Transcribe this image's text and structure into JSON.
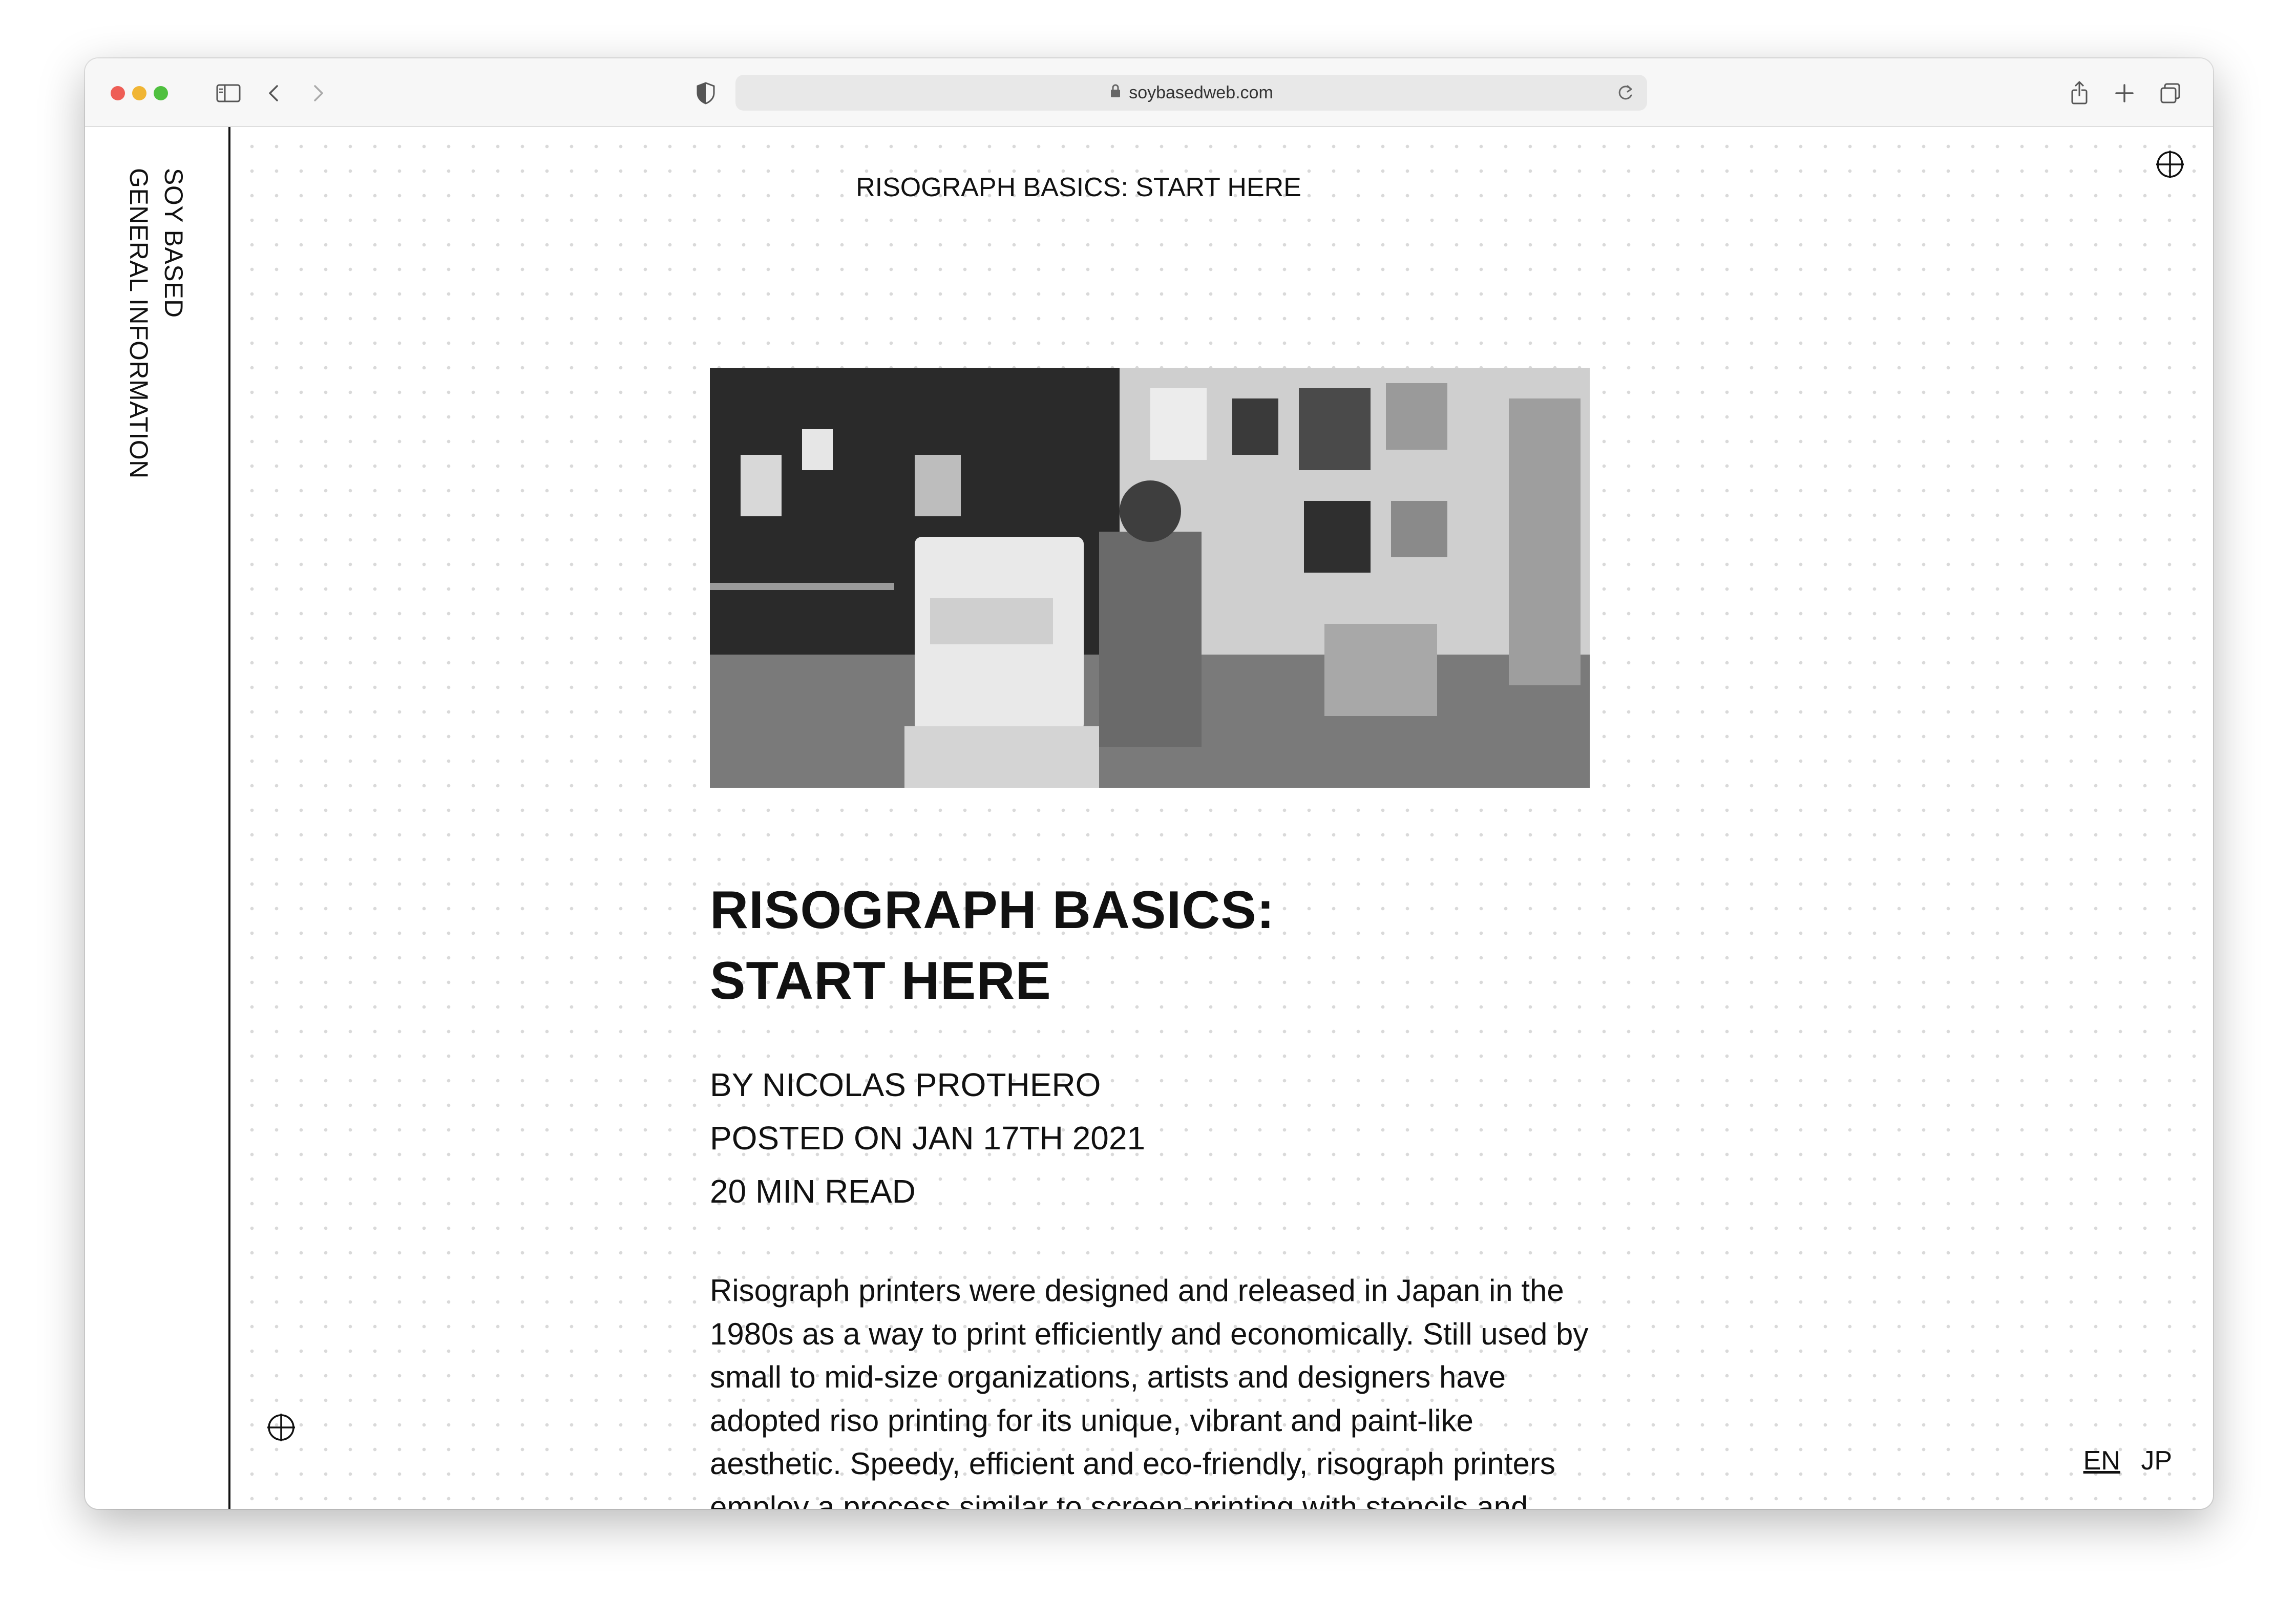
{
  "browser": {
    "url": "soybasedweb.com"
  },
  "sidebar": {
    "brand": "SOY BASED",
    "info": "GENERAL INFORMATION"
  },
  "page": {
    "header_title": "RISOGRAPH BASICS: START HERE"
  },
  "article": {
    "title_line1": "RISOGRAPH BASICS:",
    "title_line2": "START HERE",
    "author": "BY NICOLAS PROTHERO",
    "posted": "POSTED ON JAN 17TH 2021",
    "read_time": "20 MIN READ",
    "body": "Risograph printers were designed and released in Japan in the 1980s as a way to print efficiently and economically. Still used by small to mid-size organizations, artists and designers have adopted riso printing for its unique, vibrant and paint-like aesthetic. Speedy, efficient and eco-friendly, risograph printers employ a process similar to screen-printing with stencils and layers of ink."
  },
  "language": {
    "options": [
      "EN",
      "JP"
    ],
    "selected": "EN"
  },
  "icons": {
    "crosshair": "crosshair-icon",
    "shield": "shield-icon",
    "lock": "lock-icon",
    "reload": "reload-icon",
    "sidebar_toggle": "sidebar-toggle-icon",
    "share": "share-icon",
    "new_tab": "plus-icon",
    "tabs": "tabs-overview-icon"
  },
  "colors": {
    "accent": "#111111",
    "background": "#ffffff",
    "dot_grid": "#d9d9d9"
  }
}
